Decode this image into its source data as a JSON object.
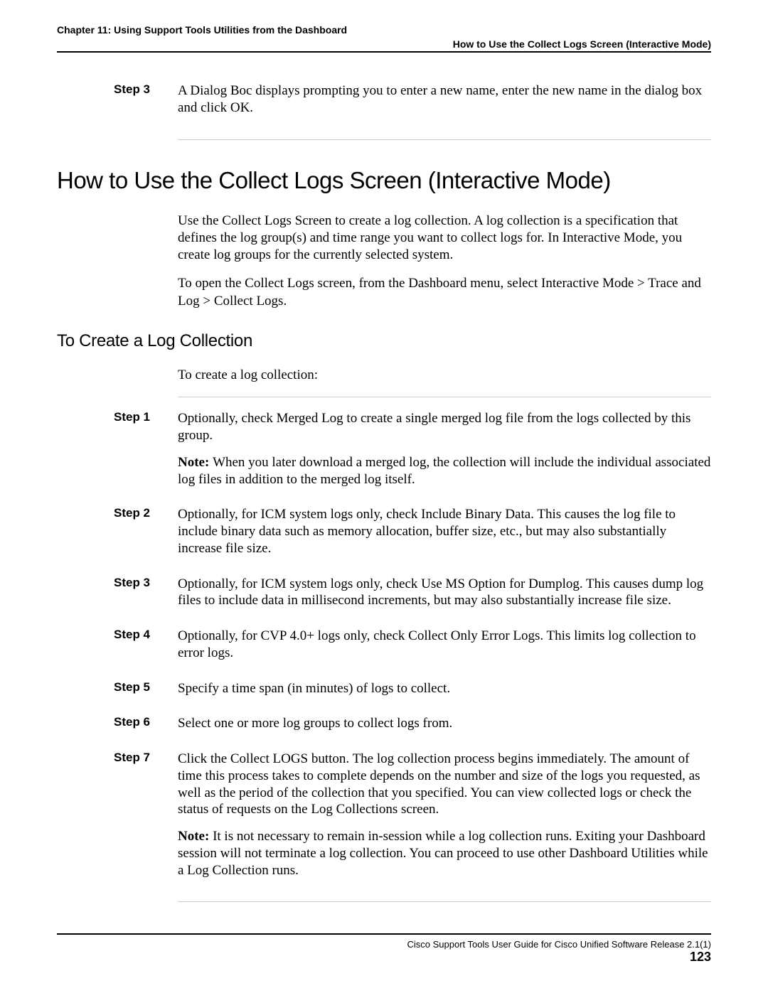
{
  "header": {
    "chapter": "Chapter 11: Using Support Tools Utilities from the Dashboard",
    "section": "How to Use the Collect Logs Screen (Interactive Mode)"
  },
  "top_step": {
    "label": "Step 3",
    "text": "A Dialog Boc displays prompting you to enter a new name, enter the new name in the dialog box and click OK."
  },
  "h1": "How to Use the Collect Logs Screen (Interactive Mode)",
  "intro": {
    "p1": "Use the Collect Logs Screen to create a log collection. A log collection is a specification that defines the log group(s) and time range you want to collect logs for. In Interactive Mode, you create log groups for the currently selected system.",
    "p2": "To open the Collect Logs screen, from the Dashboard menu, select Interactive Mode > Trace and Log > Collect Logs."
  },
  "h2": "To Create a Log Collection",
  "lead": "To create a log collection:",
  "steps": [
    {
      "label": "Step 1",
      "text": "Optionally, check Merged Log to create a single merged log file from the logs collected by this group.",
      "note": "When you later download a merged log, the collection will include the individual associated log files in addition to the merged log itself."
    },
    {
      "label": "Step 2",
      "text": "Optionally, for ICM system logs only, check Include Binary Data. This causes the log file to include binary data such as memory allocation, buffer size, etc., but may also substantially increase file size."
    },
    {
      "label": "Step 3",
      "text": "Optionally, for ICM system logs only, check Use MS Option for Dumplog. This causes dump log files to include data in millisecond increments, but may also substantially increase file size."
    },
    {
      "label": "Step 4",
      "text": "Optionally, for CVP 4.0+ logs only, check Collect Only Error Logs. This limits log collection to error logs."
    },
    {
      "label": "Step 5",
      "text": "Specify a time span (in minutes) of logs to collect."
    },
    {
      "label": "Step 6",
      "text": "Select one or more log groups to collect logs from."
    },
    {
      "label": "Step 7",
      "text": "Click the Collect LOGS button. The log collection process begins immediately. The amount of time this process takes to complete depends on the number and size of the logs you requested, as well as the period of the collection that you specified. You can view collected logs or check the status of requests on the Log Collections screen.",
      "note": "It is not necessary to remain in-session while a log collection runs. Exiting your Dashboard session will not terminate a log collection. You can proceed to use other Dashboard Utilities while a Log Collection runs."
    }
  ],
  "note_label": "Note: ",
  "footer": {
    "title": "Cisco Support Tools User Guide for Cisco Unified Software Release 2.1(1)",
    "page": "123"
  }
}
